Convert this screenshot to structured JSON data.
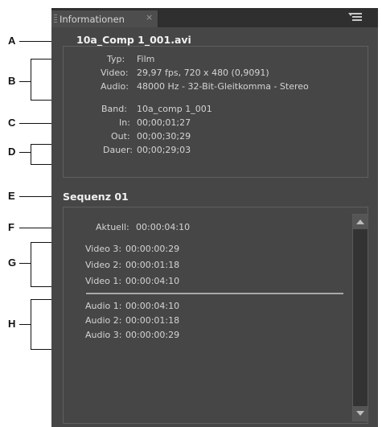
{
  "panel": {
    "tab_label": "Informationen",
    "close_glyph": "×",
    "menu_icon": "panel-menu-icon"
  },
  "clip": {
    "name": "10a_Comp 1_001.avi",
    "type_label": "Typ:",
    "type_value": "Film",
    "video_label": "Video:",
    "video_value": "29,97 fps, 720 x 480 (0,9091)",
    "audio_label": "Audio:",
    "audio_value": "48000 Hz - 32-Bit-Gleitkomma - Stereo",
    "band_label": "Band:",
    "band_value": "10a_comp 1_001",
    "in_label": "In:",
    "in_value": "00;00;01;27",
    "out_label": "Out:",
    "out_value": "00;00;30;29",
    "duration_label": "Dauer:",
    "duration_value": "00;00;29;03"
  },
  "sequence": {
    "name": "Sequenz 01",
    "current_label": "Aktuell:",
    "current_value": "00:00:04:10",
    "video_tracks": [
      {
        "label": "Video 3:",
        "value": "00:00:00:29"
      },
      {
        "label": "Video 2:",
        "value": "00:00:01:18"
      },
      {
        "label": "Video 1:",
        "value": "00:00:04:10"
      }
    ],
    "audio_tracks": [
      {
        "label": "Audio 1:",
        "value": "00:00:04:10"
      },
      {
        "label": "Audio 2:",
        "value": "00:00:01:18"
      },
      {
        "label": "Audio 3:",
        "value": "00:00:00:29"
      }
    ]
  },
  "callouts": {
    "a": "A",
    "b": "B",
    "c": "C",
    "d": "D",
    "e": "E",
    "f": "F",
    "g": "G",
    "h": "H"
  }
}
